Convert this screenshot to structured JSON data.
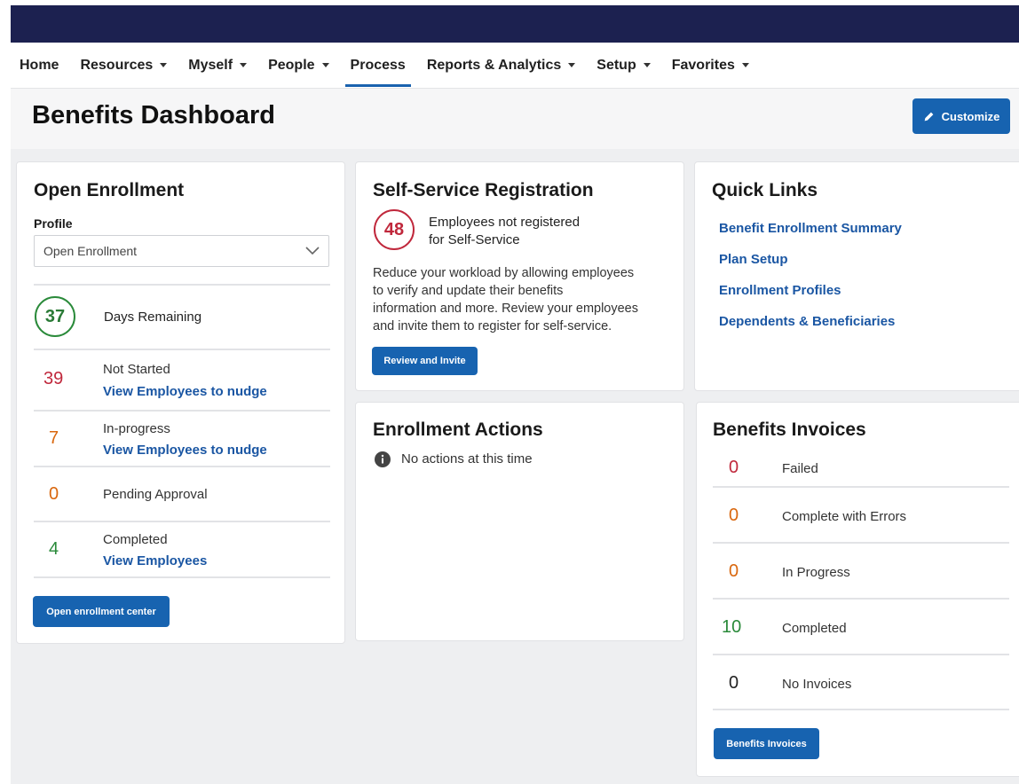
{
  "nav": {
    "items": [
      {
        "label": "Home",
        "dropdown": false,
        "active": false
      },
      {
        "label": "Resources",
        "dropdown": true,
        "active": false
      },
      {
        "label": "Myself",
        "dropdown": true,
        "active": false
      },
      {
        "label": "People",
        "dropdown": true,
        "active": false
      },
      {
        "label": "Process",
        "dropdown": false,
        "active": true
      },
      {
        "label": "Reports & Analytics",
        "dropdown": true,
        "active": false
      },
      {
        "label": "Setup",
        "dropdown": true,
        "active": false
      },
      {
        "label": "Favorites",
        "dropdown": true,
        "active": false
      }
    ]
  },
  "header": {
    "title": "Benefits Dashboard",
    "customize_label": "Customize"
  },
  "open_enrollment": {
    "title": "Open Enrollment",
    "profile_label": "Profile",
    "profile_value": "Open Enrollment",
    "days_remaining": {
      "count": "37",
      "label": "Days Remaining"
    },
    "not_started": {
      "count": "39",
      "label": "Not Started",
      "link": "View Employees to nudge"
    },
    "in_progress": {
      "count": "7",
      "label": "In-progress",
      "link": "View Employees to nudge"
    },
    "pending": {
      "count": "0",
      "label": "Pending Approval"
    },
    "completed": {
      "count": "4",
      "label": "Completed",
      "link": "View Employees"
    },
    "button_label": "Open enrollment center"
  },
  "self_service": {
    "title": "Self-Service Registration",
    "count": "48",
    "count_label_1": "Employees not registered",
    "count_label_2": "for Self-Service",
    "description_lines": [
      "Reduce your workload by allowing employees",
      "to verify and update their benefits",
      "information and more. Review your employees",
      "and invite them to register for self-service."
    ],
    "button_label": "Review and Invite"
  },
  "quick_links": {
    "title": "Quick Links",
    "links": [
      "Benefit Enrollment Summary",
      "Plan Setup",
      "Enrollment Profiles",
      "Dependents & Beneficiaries"
    ]
  },
  "enrollment_actions": {
    "title": "Enrollment Actions",
    "message": "No actions at this time"
  },
  "benefits_invoices": {
    "title": "Benefits Invoices",
    "rows": [
      {
        "count": "0",
        "label": "Failed"
      },
      {
        "count": "0",
        "label": "Complete with Errors"
      },
      {
        "count": "0",
        "label": "In Progress"
      },
      {
        "count": "10",
        "label": "Completed"
      },
      {
        "count": "0",
        "label": "No Invoices"
      }
    ],
    "button_label": "Benefits Invoices"
  },
  "colors": {
    "nav_bar": "#1c2150",
    "primary_button": "#1763b0",
    "link": "#1a56a3",
    "red": "#c0283c",
    "orange": "#d9670e",
    "green": "#2a8a3a"
  }
}
